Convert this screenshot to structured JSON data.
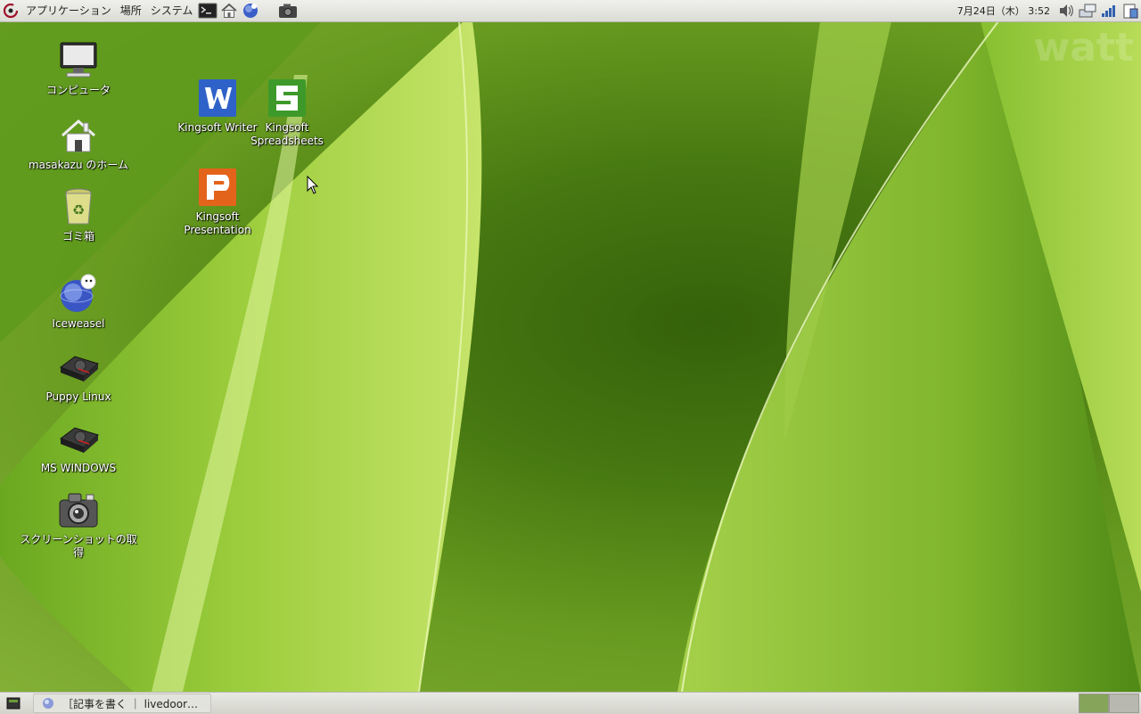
{
  "top_panel": {
    "menus": [
      "アプリケーション",
      "場所",
      "システム"
    ],
    "launchers": [
      "terminal-icon",
      "home-folder-icon",
      "iceweasel-icon",
      "screenshot-icon"
    ],
    "clock": "7月24日（木） 3:52",
    "tray_icons": [
      "volume-icon",
      "network-icon",
      "signal-icon",
      "clipboard-icon"
    ]
  },
  "desktop": {
    "watermark": "watt",
    "icons": [
      {
        "label": "コンピュータ",
        "icon": "computer-icon"
      },
      {
        "label": "masakazu のホーム",
        "icon": "home-icon"
      },
      {
        "label": "ゴミ箱",
        "icon": "trash-icon"
      },
      {
        "label": "Iceweasel",
        "icon": "iceweasel-icon"
      },
      {
        "label": "Puppy Linux",
        "icon": "drive-icon"
      },
      {
        "label": "MS WINDOWS",
        "icon": "drive-icon"
      },
      {
        "label": "スクリーンショットの取得",
        "icon": "camera-icon"
      },
      {
        "label": "Kingsoft Writer",
        "icon": "kingsoft-writer-icon"
      },
      {
        "label": "Kingsoft Spreadsheets",
        "icon": "kingsoft-spreadsheets-icon"
      },
      {
        "label": "Kingsoft Presentation",
        "icon": "kingsoft-presentation-icon"
      }
    ]
  },
  "bottom_panel": {
    "task": "［記事を書く ｜ livedoor…",
    "workspaces": [
      {
        "active": true
      },
      {
        "active": false
      }
    ]
  },
  "colors": {
    "writer": "#2f62c8",
    "spreadsheets": "#3d9a2a",
    "presentation": "#e4631a"
  }
}
